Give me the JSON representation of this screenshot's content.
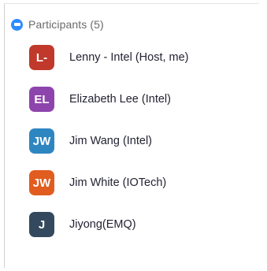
{
  "header": {
    "title": "Participants (5)",
    "logo_icon": "zoom-logo-icon"
  },
  "participants": [
    {
      "initials": "L-",
      "name": "Lenny - Intel (Host, me)",
      "color": "#c0392b"
    },
    {
      "initials": "EL",
      "name": "Elizabeth Lee (Intel)",
      "color": "#8e44ad"
    },
    {
      "initials": "JW",
      "name": "Jim Wang (Intel)",
      "color": "#2e86c1"
    },
    {
      "initials": "JW",
      "name": "Jim White (IOTech)",
      "color": "#e05d1f"
    },
    {
      "initials": "J",
      "name": "Jiyong(EMQ)",
      "color": "#34495e"
    }
  ]
}
